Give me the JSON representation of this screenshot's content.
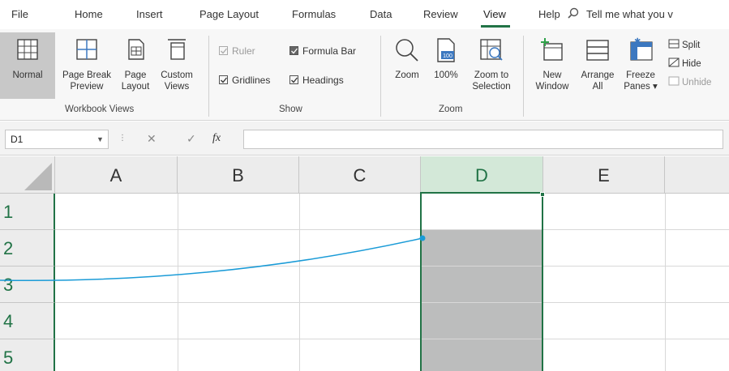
{
  "tabs": [
    "File",
    "Home",
    "Insert",
    "Page Layout",
    "Formulas",
    "Data",
    "Review",
    "View",
    "Help"
  ],
  "active_tab": "View",
  "search": {
    "label": "Tell me what you v",
    "icon": "search-icon"
  },
  "ribbon": {
    "workbook_views": {
      "label": "Workbook Views",
      "normal": "Normal",
      "page_break_1": "Page Break",
      "page_break_2": "Preview",
      "page_layout_1": "Page",
      "page_layout_2": "Layout",
      "custom_1": "Custom",
      "custom_2": "Views"
    },
    "show": {
      "label": "Show",
      "ruler": "Ruler",
      "formula_bar": "Formula Bar",
      "gridlines": "Gridlines",
      "headings": "Headings"
    },
    "zoom": {
      "label": "Zoom",
      "zoom": "Zoom",
      "hundred": "100%",
      "hundred_icon_text": "100",
      "zoom_sel_1": "Zoom to",
      "zoom_sel_2": "Selection"
    },
    "window": {
      "new_1": "New",
      "new_2": "Window",
      "arrange_1": "Arrange",
      "arrange_2": "All",
      "freeze_1": "Freeze",
      "freeze_2": "Panes ▾",
      "split": "Split",
      "hide": "Hide",
      "unhide": "Unhide"
    }
  },
  "formula_bar": {
    "name_box": "D1",
    "cancel": "✕",
    "enter": "✓",
    "fx": "fx",
    "value": ""
  },
  "grid": {
    "columns": [
      "A",
      "B",
      "C",
      "D",
      "E"
    ],
    "rows": [
      "1",
      "2",
      "3",
      "4",
      "5"
    ],
    "selected_column": "D",
    "active_cell": "D1"
  },
  "colors": {
    "accent": "#217346",
    "selection_fill": "#bcbdbd",
    "callout_line": "#1a9bd7"
  }
}
